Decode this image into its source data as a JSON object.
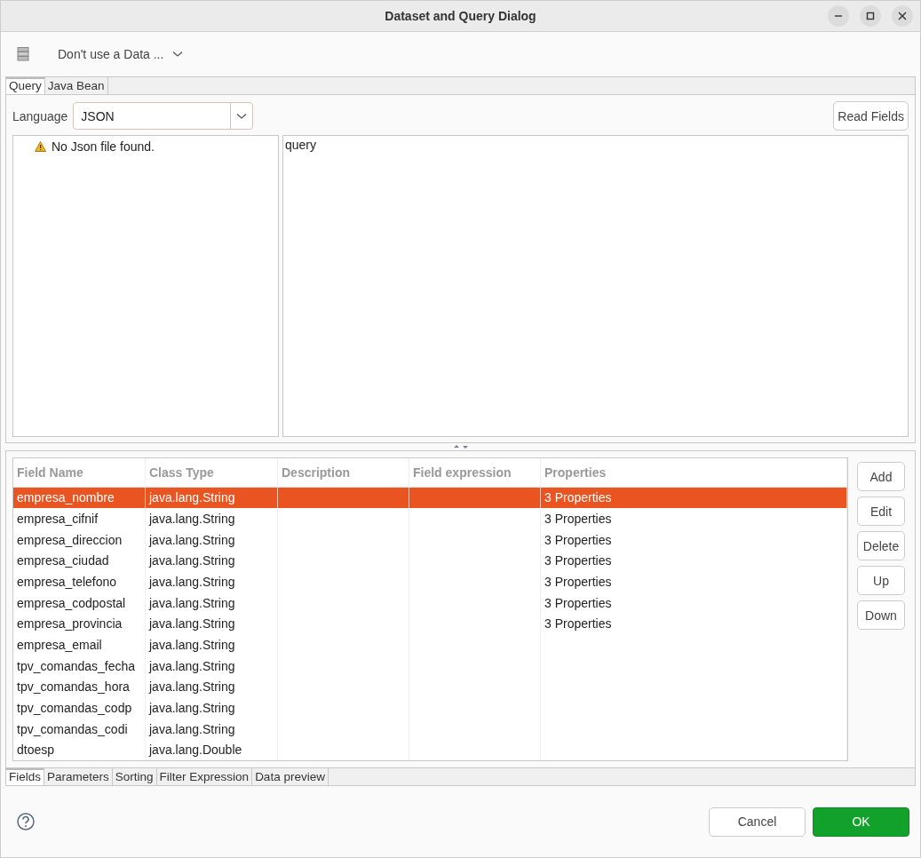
{
  "window": {
    "title": "Dataset and Query Dialog"
  },
  "toolbar": {
    "data_adapter": "Don't use a Data ..."
  },
  "query_tabs": [
    {
      "label": "Query",
      "selected": true
    },
    {
      "label": "Java Bean",
      "selected": false
    }
  ],
  "language": {
    "label": "Language",
    "value": "JSON"
  },
  "read_fields_button": "Read Fields",
  "tree_message": "No Json file found.",
  "query_text": "query",
  "table": {
    "columns": [
      "Field Name",
      "Class Type",
      "Description",
      "Field expression",
      "Properties"
    ],
    "rows": [
      {
        "name": "empresa_nombre",
        "class_type": "java.lang.String",
        "properties": "3 Properties",
        "selected": true
      },
      {
        "name": "empresa_cifnif",
        "class_type": "java.lang.String",
        "properties": "3 Properties",
        "selected": false
      },
      {
        "name": "empresa_direccion",
        "class_type": "java.lang.String",
        "properties": "3 Properties",
        "selected": false
      },
      {
        "name": "empresa_ciudad",
        "class_type": "java.lang.String",
        "properties": "3 Properties",
        "selected": false
      },
      {
        "name": "empresa_telefono",
        "class_type": "java.lang.String",
        "properties": "3 Properties",
        "selected": false
      },
      {
        "name": "empresa_codpostal",
        "class_type": "java.lang.String",
        "properties": "3 Properties",
        "selected": false
      },
      {
        "name": "empresa_provincia",
        "class_type": "java.lang.String",
        "properties": "3 Properties",
        "selected": false
      },
      {
        "name": "empresa_email",
        "class_type": "java.lang.String",
        "selected": false
      },
      {
        "name": "tpv_comandas_fecha",
        "class_type": "java.lang.String",
        "selected": false
      },
      {
        "name": "tpv_comandas_hora",
        "class_type": "java.lang.String",
        "selected": false
      },
      {
        "name": "tpv_comandas_codp",
        "class_type": "java.lang.String",
        "selected": false
      },
      {
        "name": "tpv_comandas_codi",
        "class_type": "java.lang.String",
        "selected": false
      },
      {
        "name": "dtoesp",
        "class_type": "java.lang.Double",
        "selected": false
      }
    ]
  },
  "side_buttons": [
    "Add",
    "Edit",
    "Delete",
    "Up",
    "Down"
  ],
  "bottom_tabs": [
    {
      "label": "Fields",
      "selected": true
    },
    {
      "label": "Parameters",
      "selected": false
    },
    {
      "label": "Sorting",
      "selected": false
    },
    {
      "label": "Filter Expression",
      "selected": false
    },
    {
      "label": "Data preview",
      "selected": false
    }
  ],
  "footer": {
    "cancel": "Cancel",
    "ok": "OK"
  }
}
